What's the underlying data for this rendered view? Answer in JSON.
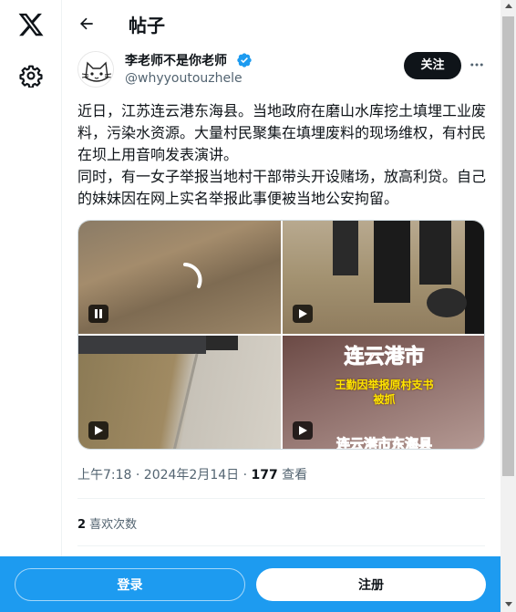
{
  "header": {
    "title": "帖子"
  },
  "author": {
    "name": "李老师不是你老师",
    "handle": "@whyyoutouzhele",
    "follow_label": "关注"
  },
  "tweet": {
    "text": "近日，江苏连云港东海县。当地政府在磨山水库挖土填埋工业废料，污染水资源。大量村民聚集在填埋废料的现场维权，有村民在坝上用音响发表演讲。\n同时，有一女子举报当地村干部带头开设赌场，放高利贷。自己的妹妹因在网上实名举报此事便被当地公安拘留。",
    "time": "上午7:18 · 2024年2月14日 · ",
    "views_count": "177",
    "views_label": " 查看",
    "likes_count": "2",
    "likes_label": " 喜欢次数"
  },
  "media": {
    "video4_caption_title": "连云港市",
    "video4_caption_line1": "王勤因举报原村支书",
    "video4_caption_line2": "被抓",
    "video4_caption_bottom": "连云港市东海县"
  },
  "bottom": {
    "login_label": "登录",
    "signup_label": "注册"
  },
  "colors": {
    "accent": "#1d9bf0",
    "verified": "#1d9bf0",
    "text": "#0f1419",
    "secondary": "#536471"
  },
  "icons": [
    "x-logo-icon",
    "gear-icon",
    "back-arrow-icon",
    "verified-badge-icon",
    "more-icon",
    "pause-icon",
    "play-icon",
    "loading-spinner-icon"
  ]
}
